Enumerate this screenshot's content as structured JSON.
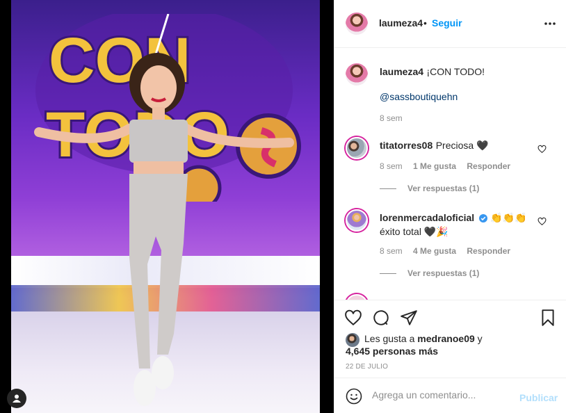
{
  "post": {
    "author": "laumeza4",
    "follow_label": "Seguir",
    "separator": "•",
    "caption_text": "¡CON TODO!",
    "caption_mention": "@sassboutiquehn",
    "caption_time": "8 sem",
    "photo_sign_text": [
      "CON",
      "TODO"
    ]
  },
  "comments": [
    {
      "username": "titatorres08",
      "text": "Preciosa 🖤",
      "time": "8 sem",
      "likes": "1 Me gusta",
      "reply_label": "Responder",
      "view_replies": "Ver respuestas (1)",
      "verified": false
    },
    {
      "username": "lorenmercadaloficial",
      "text": "👏👏👏",
      "text2": "éxito total 🖤🎉",
      "time": "8 sem",
      "likes": "4 Me gusta",
      "reply_label": "Responder",
      "view_replies": "Ver respuestas (1)",
      "verified": true
    }
  ],
  "likes": {
    "prefix": "Les gusta a",
    "user": "medranoe09",
    "connector": "y",
    "others": "4,645 personas más"
  },
  "date": "22 DE JULIO",
  "comment_box": {
    "placeholder": "Agrega un comentario...",
    "publish_label": "Publicar"
  },
  "colors": {
    "link": "#0095f6",
    "publish_disabled": "#b2dffc",
    "muted": "#8e8e8e",
    "verified": "#3897f0"
  },
  "icons": [
    "more-icon",
    "heart-icon",
    "comment-icon",
    "share-icon",
    "bookmark-icon",
    "emoji-icon",
    "user-tag-icon",
    "verified-icon"
  ]
}
